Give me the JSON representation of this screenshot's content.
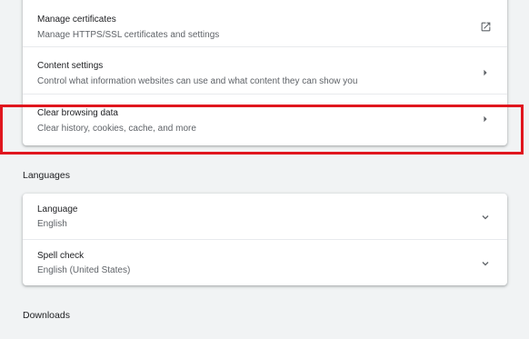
{
  "privacy": {
    "manage_certificates": {
      "title": "Manage certificates",
      "subtitle": "Manage HTTPS/SSL certificates and settings",
      "icon": "open-in-new-icon"
    },
    "content_settings": {
      "title": "Content settings",
      "subtitle": "Control what information websites can use and what content they can show you",
      "icon": "arrow-right-icon"
    },
    "clear_browsing_data": {
      "title": "Clear browsing data",
      "subtitle": "Clear history, cookies, cache, and more",
      "icon": "arrow-right-icon"
    }
  },
  "languages": {
    "section_title": "Languages",
    "language": {
      "title": "Language",
      "value": "English",
      "icon": "chevron-down-icon"
    },
    "spell_check": {
      "title": "Spell check",
      "value": "English (United States)",
      "icon": "chevron-down-icon"
    }
  },
  "downloads": {
    "section_title": "Downloads"
  },
  "colors": {
    "highlight": "#e0161e",
    "background": "#f1f3f4",
    "card": "#ffffff"
  }
}
